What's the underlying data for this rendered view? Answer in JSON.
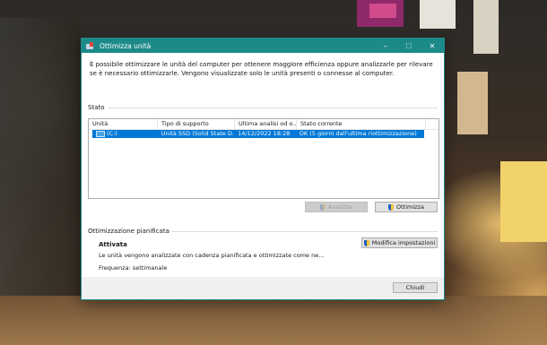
{
  "window": {
    "title": "Ottimizza unità",
    "controls": {
      "minimize": "–",
      "maximize": "☐",
      "close": "✕"
    }
  },
  "intro_text": "È possibile ottimizzare le unità del computer per ottenere maggiore efficienza oppure analizzarle per rilevare se è necessario ottimizzarle. Vengono visualizzate solo le unità presenti o connesse al computer.",
  "status_section": {
    "label": "Stato",
    "columns": [
      "Unità",
      "Tipo di supporto",
      "Ultima analisi od o...",
      "Stato corrente"
    ],
    "rows": [
      {
        "drive": "(C:)",
        "media_type": "Unità SSD (Solid State D...",
        "last_run": "14/12/2022 18:28",
        "current_status": "OK (5 giorni dall'ultima riottimizzazione)",
        "selected": true
      }
    ],
    "buttons": {
      "analyze": "Analizza",
      "optimize": "Ottimizza"
    }
  },
  "scheduled_section": {
    "label": "Ottimizzazione pianificata",
    "status": "Attivata",
    "description": "Le unità vengono analizzate con cadenza pianificata e ottimizzate come ne...",
    "frequency": "Frequenza: settimanale",
    "change_settings_button": "Modifica impostazioni"
  },
  "footer": {
    "close_button": "Chiudi"
  },
  "colors": {
    "titlebar": "#1d8a8a",
    "selection": "#0078d7"
  },
  "icons": [
    "defrag-app-icon",
    "drive-icon",
    "uac-shield-icon"
  ]
}
